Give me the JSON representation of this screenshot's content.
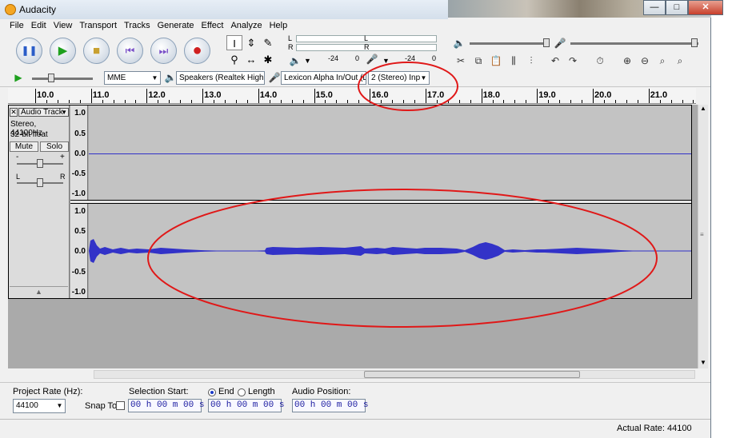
{
  "window": {
    "title": "Audacity",
    "minimize": "—",
    "maximize": "□",
    "close": "✕"
  },
  "menu": [
    "File",
    "Edit",
    "View",
    "Transport",
    "Tracks",
    "Generate",
    "Effect",
    "Analyze",
    "Help"
  ],
  "transport": {
    "pause": "❚❚",
    "play": "▶",
    "stop": "■",
    "skip_start": "⏮",
    "skip_end": "⏭",
    "record": "●"
  },
  "tools": {
    "select": "I",
    "envelope": "⇕",
    "draw": "✎",
    "zoom": "⚲",
    "timeshift": "↔",
    "multi": "✱"
  },
  "meters": {
    "left": "L",
    "right": "R",
    "scale_a": "-24",
    "scale_b": "0",
    "scale_c": "-24",
    "scale_d": "0"
  },
  "device": {
    "host": "MME",
    "output": "Speakers (Realtek High",
    "input": "Lexicon Alpha In/Out (L",
    "channels": "2 (Stereo) Inp"
  },
  "ruler": [
    "10.0",
    "11.0",
    "12.0",
    "13.0",
    "14.0",
    "15.0",
    "16.0",
    "17.0",
    "18.0",
    "19.0",
    "20.0",
    "21.0"
  ],
  "track": {
    "name": "Audio Track",
    "close": "✕",
    "menu_arrow": "▼",
    "info_line1": "Stereo, 44100Hz",
    "info_line2": "32-bit float",
    "mute": "Mute",
    "solo": "Solo",
    "gain_minus": "-",
    "gain_plus": "+",
    "pan_left": "L",
    "pan_right": "R",
    "collapse": "▲",
    "scale": [
      "1.0",
      "0.5",
      "0.0",
      "-0.5",
      "-1.0"
    ]
  },
  "selection": {
    "project_rate_label": "Project Rate (Hz):",
    "project_rate": "44100",
    "snap_to": "Snap To",
    "selection_start_label": "Selection Start:",
    "end_label": "End",
    "length_label": "Length",
    "audio_position_label": "Audio Position:",
    "time_value": "00 h 00 m 00 s"
  },
  "status": {
    "actual_rate": "Actual Rate: 44100"
  },
  "colors": {
    "waveform": "#3232c8",
    "annotation": "#e01818",
    "track_bg": "#c3c3c3"
  }
}
